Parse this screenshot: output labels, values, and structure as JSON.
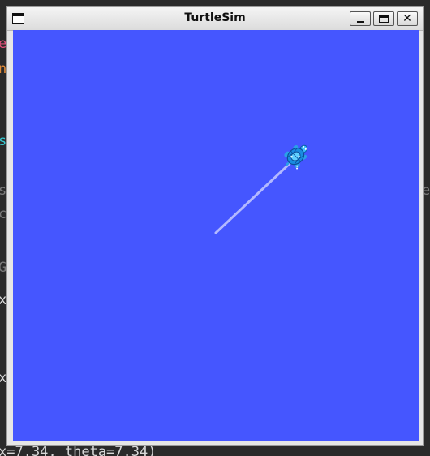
{
  "window": {
    "title": "TurtleSim",
    "buttons": {
      "minimize": "minimize-icon",
      "maximize": "maximize-icon",
      "close": "close-icon"
    }
  },
  "canvas": {
    "background_color": "#4556ff",
    "pen_color": "#b3b9ff"
  },
  "background_terminal": {
    "visible_text": [
      "et",
      "nc",
      "si",
      "s",
      "c",
      "e",
      "G",
      "x",
      "x",
      "x=7.34, theta=7.34)"
    ]
  }
}
